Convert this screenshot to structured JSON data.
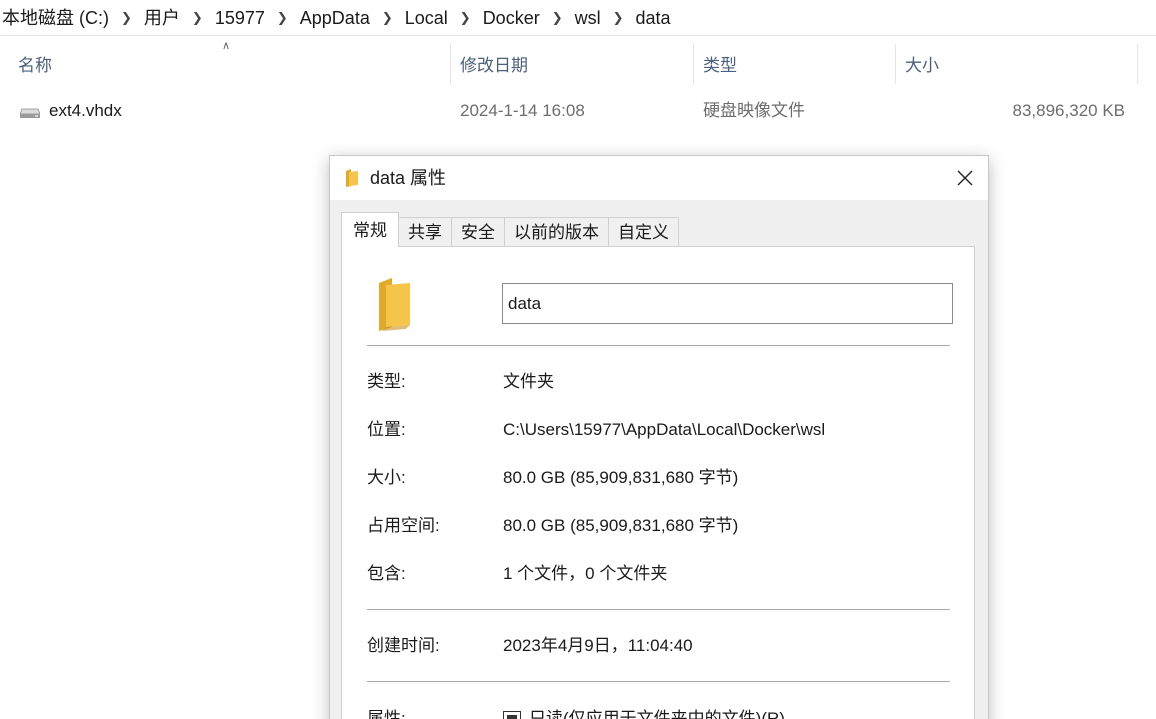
{
  "breadcrumb": [
    "本地磁盘 (C:)",
    "用户",
    "15977",
    "AppData",
    "Local",
    "Docker",
    "wsl",
    "data"
  ],
  "columns": {
    "name": "名称",
    "modified": "修改日期",
    "type": "类型",
    "size": "大小"
  },
  "file": {
    "name": "ext4.vhdx",
    "modified": "2024-1-14 16:08",
    "type": "硬盘映像文件",
    "size": "83,896,320 KB",
    "icon": "disk-image-icon"
  },
  "dialog": {
    "title": "data 属性",
    "tabs": [
      "常规",
      "共享",
      "安全",
      "以前的版本",
      "自定义"
    ],
    "active_tab": "常规",
    "folder_name": "data",
    "props": {
      "type_label": "类型:",
      "type_value": "文件夹",
      "location_label": "位置:",
      "location_value": "C:\\Users\\15977\\AppData\\Local\\Docker\\wsl",
      "size_label": "大小:",
      "size_value": "80.0 GB (85,909,831,680 字节)",
      "disk_label": "占用空间:",
      "disk_value": "80.0 GB (85,909,831,680 字节)",
      "contains_label": "包含:",
      "contains_value": "1 个文件，0 个文件夹",
      "created_label": "创建时间:",
      "created_value": "2023年4月9日，11:04:40",
      "attributes_label": "属性:",
      "readonly_label": "只读(仅应用于文件夹中的文件)(R)"
    }
  },
  "colors": {
    "header_text": "#4c607a",
    "folder_yellow": "#f4c54a",
    "dialog_bg": "#f0f0f0"
  }
}
